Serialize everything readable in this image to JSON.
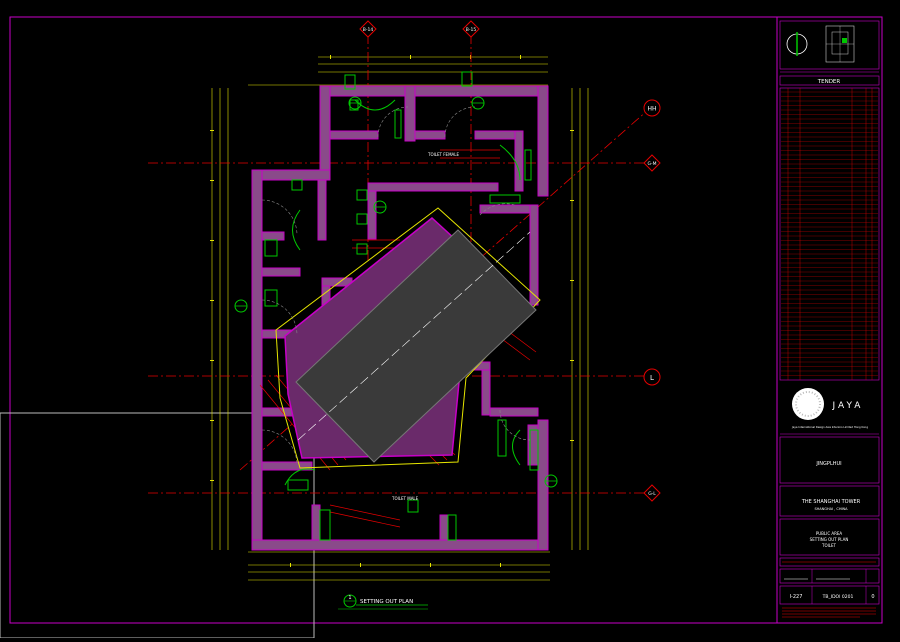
{
  "drawing": {
    "grid_labels": {
      "top_left": "B-14",
      "top_right": "B-15",
      "right_1": "HH",
      "right_2": "G-M",
      "right_3": "L",
      "right_4": "G-L"
    },
    "room_labels": {
      "upper": "TOILET FEMALE",
      "lower": "TOILET MALE"
    },
    "plan_title_number": "1",
    "plan_title": "SETTING OUT PLAN"
  },
  "title_block": {
    "status": "TENDER",
    "company": "JAYA",
    "company_tagline": "Jaya  International  Design   Asia   Interiors  Limited  Hong Kong",
    "client": "JINGPLHUI",
    "project_title": "THE SHANGHAI TOWER",
    "project_location": "SHANGHAI , CHINA",
    "drawing_title_1": "PUBLIC AREA",
    "drawing_title_2": "SETTING OUT PLAN",
    "drawing_title_3": "TOILET",
    "drawing_no": "I-227",
    "drawing_ref": "TB_IDOI 0201",
    "revision": "0"
  },
  "colors": {
    "background": "#000000",
    "border": "#c800c8",
    "wall": "#c800c8",
    "wall_fill": "#8a4a8a",
    "dims": "#e6e600",
    "grid": "#e60000",
    "fixtures": "#00c800",
    "core": "#3a3a3a",
    "text": "#ffffff"
  }
}
